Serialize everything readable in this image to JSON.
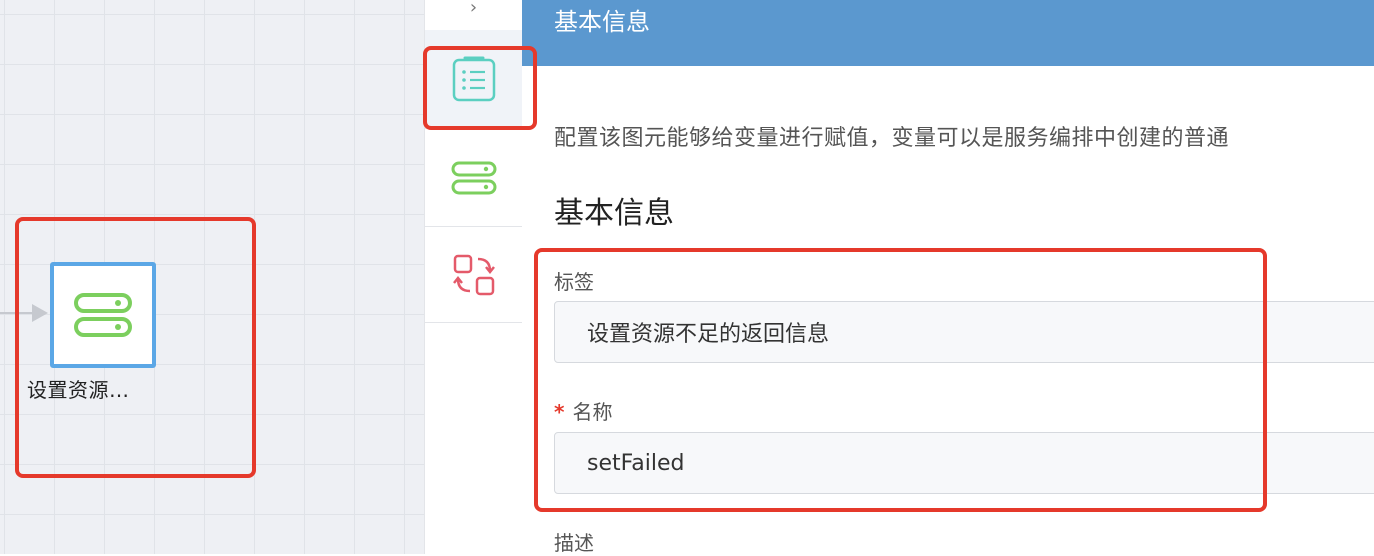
{
  "canvas": {
    "node": {
      "label": "设置资源…",
      "icon": "assign-variable-icon"
    }
  },
  "tabs": [
    {
      "name": "collapse-chevron",
      "icon": "chevron-right-icon"
    },
    {
      "name": "basic-info",
      "icon": "clipboard-list-icon",
      "active": true
    },
    {
      "name": "assign-variable",
      "icon": "assign-variable-icon"
    },
    {
      "name": "exchange",
      "icon": "exchange-icon"
    }
  ],
  "panel": {
    "header": "基本信息",
    "description": "配置该图元能够给变量进行赋值，变量可以是服务编排中创建的普通",
    "section_title": "基本信息",
    "fields": {
      "tag": {
        "label": "标签",
        "value": "设置资源不足的返回信息"
      },
      "name": {
        "label": "名称",
        "required_mark": "*",
        "value": "setFailed"
      },
      "desc": {
        "label": "描述"
      }
    }
  },
  "colors": {
    "header_bg": "#5b98cf",
    "highlight": "#e5392b",
    "node_border": "#5ba7e6",
    "green_icon": "#7ccf5e",
    "teal_icon": "#5bcfc1",
    "red_icon": "#e45a6a"
  }
}
